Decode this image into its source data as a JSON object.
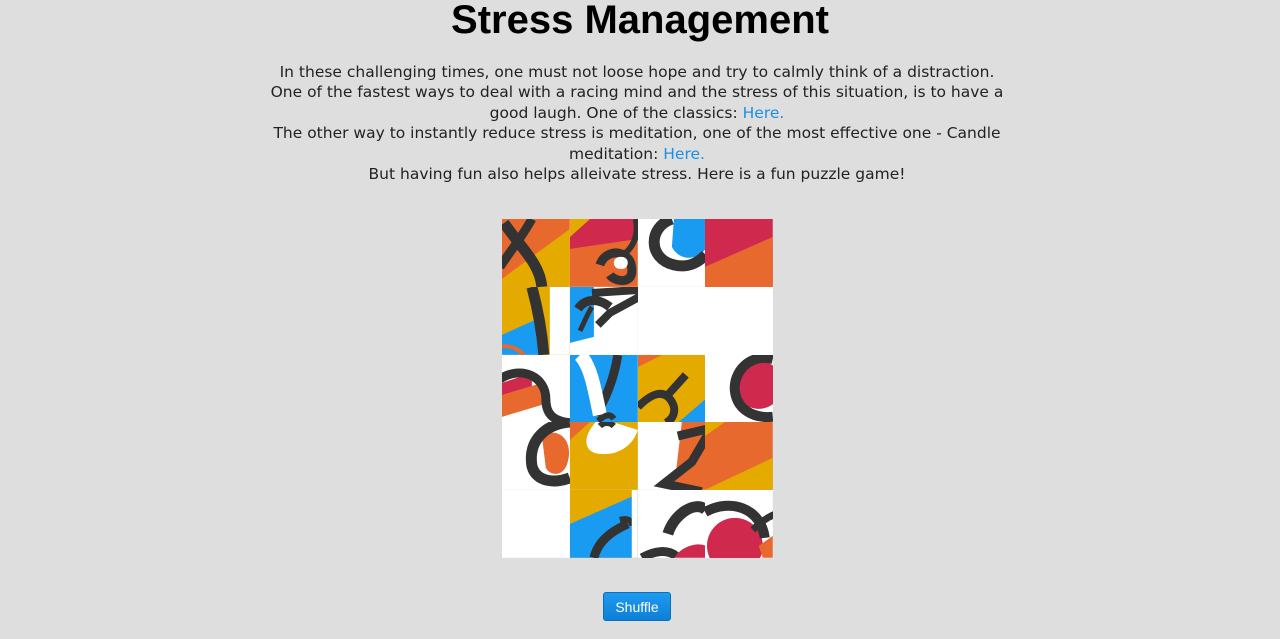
{
  "page": {
    "title": "Stress Management"
  },
  "intro": {
    "line1": "In these challenging times, one must not loose hope and try to calmly think of a distraction.",
    "line2_pre": "One of the fastest ways to deal with a racing mind and the stress of this situation, is to have a good laugh. One of the classics: ",
    "link1": "Here.",
    "line3_pre": "The other way to instantly reduce stress is meditation, one of the most effective one - Candle meditation: ",
    "link2": "Here.",
    "line4": "But having fun also helps alleivate stress. Here is a fun puzzle game!"
  },
  "puzzle": {
    "rows": 5,
    "cols": 4,
    "empty_tile": "row 2, column 4",
    "palette": {
      "orange": "#e8692e",
      "crimson": "#cf2a4e",
      "yellow": "#e4aa00",
      "blue": "#1a9bf2",
      "dark": "#333333",
      "white": "#ffffff"
    }
  },
  "controls": {
    "shuffle_label": "Shuffle",
    "shuffle_color": "#1585de"
  }
}
